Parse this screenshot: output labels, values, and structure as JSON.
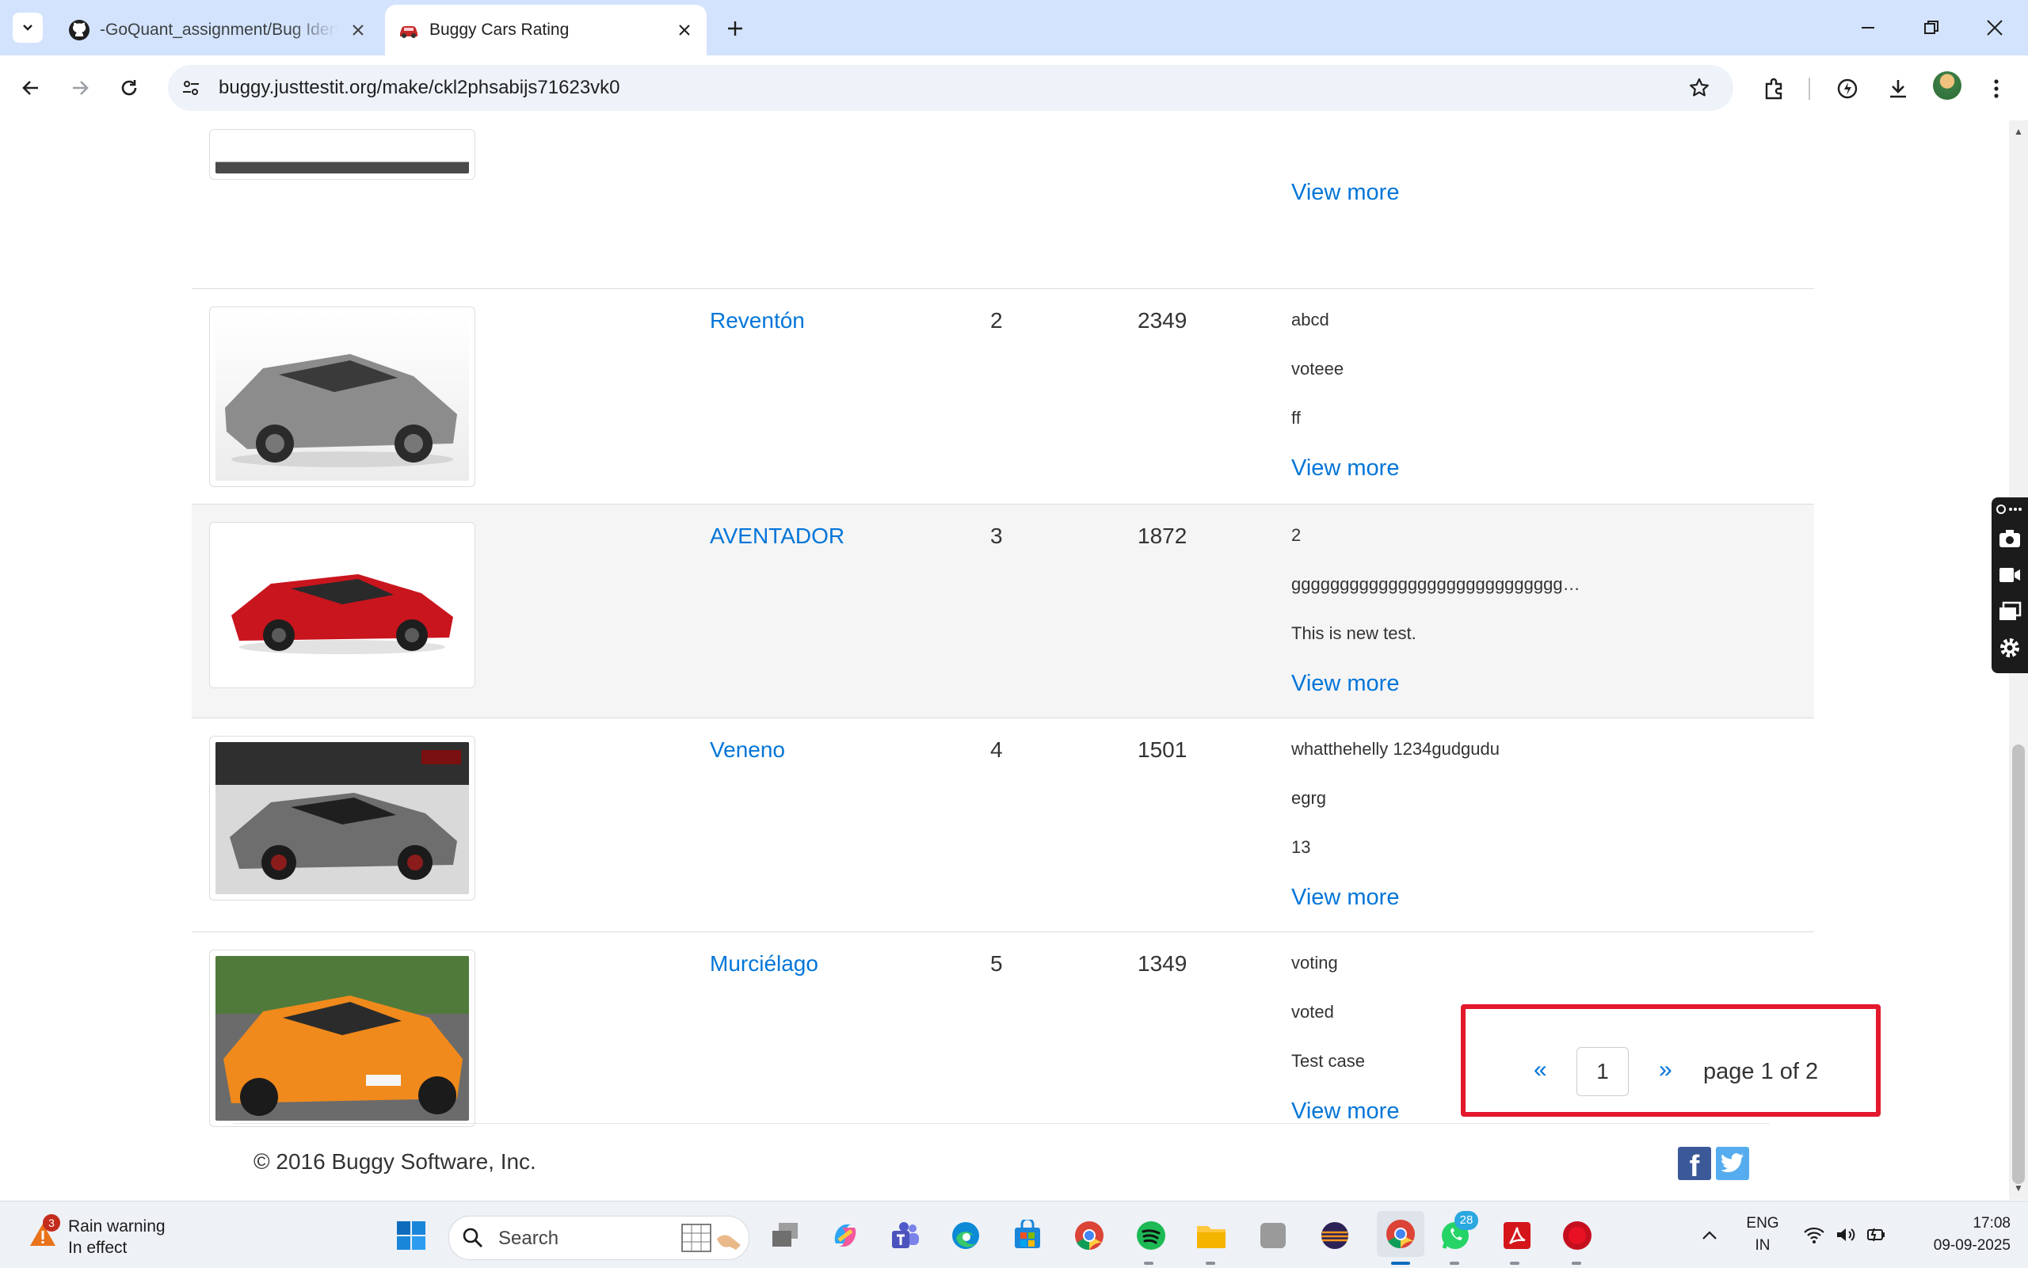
{
  "browser": {
    "tabs": [
      {
        "title": "-GoQuant_assignment/Bug Identification",
        "active": false
      },
      {
        "title": "Buggy Cars Rating",
        "active": true
      }
    ],
    "url": "buggy.justtestit.org/make/ckl2phsabijs71623vk0"
  },
  "table": {
    "top_partial_row": {
      "view_more": "View more"
    },
    "rows": [
      {
        "model": "Reventón",
        "rank": "2",
        "votes": "2349",
        "comments": [
          "abcd",
          "voteee",
          "ff"
        ],
        "view_more": "View more",
        "car_color": "#8c8c8c"
      },
      {
        "model": "AVENTADOR",
        "rank": "3",
        "votes": "1872",
        "comments": [
          "2",
          "gggggggggggggggggggggggggggg…",
          "This is new test."
        ],
        "view_more": "View more",
        "car_color": "#c9151e"
      },
      {
        "model": "Veneno",
        "rank": "4",
        "votes": "1501",
        "comments": [
          "whatthehelly 1234gudgudu",
          "egrg",
          "13"
        ],
        "view_more": "View more",
        "car_color": "#6e6e6e"
      },
      {
        "model": "Murciélago",
        "rank": "5",
        "votes": "1349",
        "comments": [
          "voting",
          "voted",
          "Test case"
        ],
        "view_more": "View more",
        "car_color": "#f08a1c"
      }
    ]
  },
  "pagination": {
    "prev": "«",
    "next": "»",
    "page_value": "1",
    "status": "page 1 of 2"
  },
  "footer": {
    "copyright": "© 2016 Buggy Software, Inc.",
    "facebook": "f"
  },
  "taskbar": {
    "weather_title": "Rain warning",
    "weather_sub": "In effect",
    "weather_badge": "3",
    "search_placeholder": "Search",
    "whatsapp_badge": "28",
    "lang_line1": "ENG",
    "lang_line2": "IN",
    "time": "17:08",
    "date": "09-09-2025"
  }
}
